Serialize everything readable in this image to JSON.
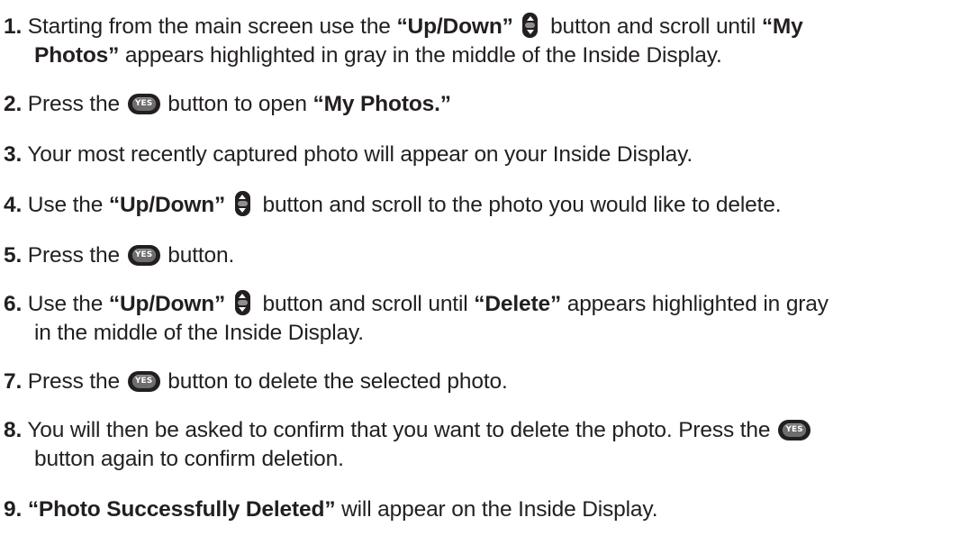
{
  "steps": [
    {
      "num": "1.",
      "t1": " Starting from the main screen use the ",
      "q1": "“Up/Down”",
      "t2": " button and scroll until ",
      "q2a": "“My",
      "q2b": "Photos”",
      "t3": " appears highlighted in gray in the middle of the Inside Display."
    },
    {
      "num": "2.",
      "t1": " Press  the ",
      "t2": " button to open ",
      "q1": "“My Photos.”"
    },
    {
      "num": "3.",
      "t1": " Your most recently captured photo will appear on your Inside Display."
    },
    {
      "num": "4.",
      "t1": " Use the ",
      "q1": "“Up/Down”",
      "t2": " button and scroll to the photo you would like to delete."
    },
    {
      "num": "5.",
      "t1": " Press  the ",
      "t2": " button."
    },
    {
      "num": "6.",
      "t1": " Use the ",
      "q1": "“Up/Down”",
      "t2": " button and scroll until ",
      "q2": "“Delete”",
      "t3": " appears highlighted in gray",
      "t4": "in the middle of the Inside Display."
    },
    {
      "num": "7.",
      "t1": " Press  the ",
      "t2": " button to delete the selected photo."
    },
    {
      "num": "8.",
      "t1": " You will then be asked to confirm that you want to delete the photo. Press the ",
      "t2": "button again to confirm deletion."
    },
    {
      "num": "9.",
      "q1": "“Photo Successfully Deleted”",
      "t1": " will appear on the Inside Display."
    }
  ],
  "icons": {
    "yes_key_label": "YES"
  }
}
